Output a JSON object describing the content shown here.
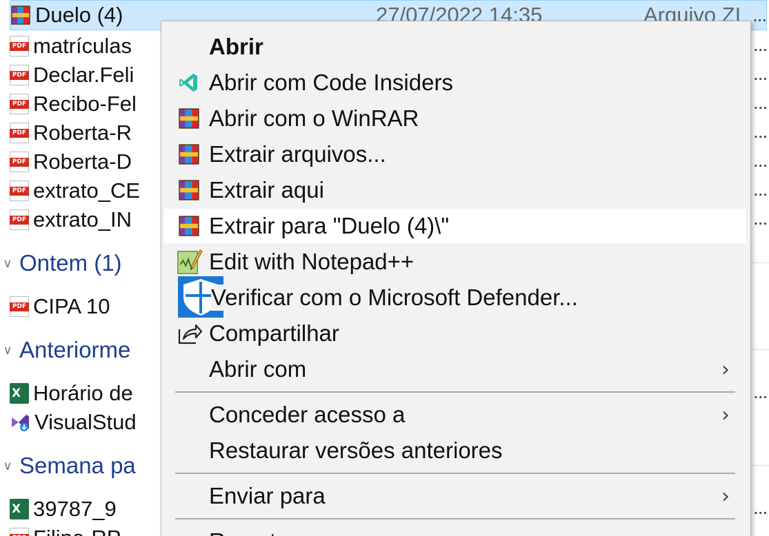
{
  "files": [
    {
      "name": "Duelo (4)",
      "icon": "winrar-archive-icon",
      "date": "27/07/2022 14:35",
      "type": "Arquivo ZI",
      "selected": true
    },
    {
      "name": "matrículas",
      "icon": "pdf-icon"
    },
    {
      "name": "Declar.Feli",
      "icon": "pdf-icon"
    },
    {
      "name": "Recibo-Fel",
      "icon": "pdf-icon"
    },
    {
      "name": "Roberta-R",
      "icon": "pdf-icon"
    },
    {
      "name": "Roberta-D",
      "icon": "pdf-icon"
    },
    {
      "name": "extrato_CE",
      "icon": "pdf-icon"
    },
    {
      "name": "extrato_IN",
      "icon": "pdf-icon"
    }
  ],
  "groups": {
    "yesterday": {
      "label": "Ontem (1)",
      "files": [
        {
          "name": "CIPA 10",
          "icon": "pdf-icon"
        }
      ]
    },
    "earlier": {
      "label": "Anteriorme",
      "files": [
        {
          "name": "Horário de",
          "icon": "excel-icon"
        },
        {
          "name": "VisualStud",
          "icon": "visual-studio-installer-icon"
        }
      ]
    },
    "last_week": {
      "label": "Semana pa",
      "files": [
        {
          "name": "39787_9",
          "icon": "excel-icon"
        },
        {
          "name": "Filipe-RP",
          "icon": "pdf-icon"
        }
      ]
    }
  },
  "ellipsis": "...",
  "context_menu": {
    "items": [
      {
        "label": "Abrir",
        "bold": true,
        "icon": ""
      },
      {
        "label": "Abrir com Code Insiders",
        "icon": "vscode-insiders-icon"
      },
      {
        "label": "Abrir com o WinRAR",
        "icon": "winrar-icon"
      },
      {
        "label": "Extrair arquivos...",
        "icon": "winrar-icon"
      },
      {
        "label": "Extrair aqui",
        "icon": "winrar-icon"
      },
      {
        "label": "Extrair para \"Duelo (4)\\\"",
        "icon": "winrar-icon",
        "hover": true
      },
      {
        "label": "Edit with Notepad++",
        "icon": "notepad-plus-plus-icon"
      },
      {
        "label": "Verificar com o Microsoft Defender...",
        "icon": "defender-shield-icon"
      },
      {
        "label": "Compartilhar",
        "icon": "share-icon"
      },
      {
        "label": "Abrir com",
        "icon": "",
        "submenu": true
      },
      {
        "label": "Conceder acesso a",
        "icon": "",
        "submenu": true
      },
      {
        "label": "Restaurar versões anteriores",
        "icon": ""
      },
      {
        "label": "Enviar para",
        "icon": "",
        "submenu": true
      },
      {
        "label": "Recortar",
        "icon": ""
      }
    ],
    "submenu_arrow": "›"
  },
  "colors": {
    "selection": "#cce8ff",
    "group_header": "#1e3e8f",
    "menu_bg": "#f2f2f2",
    "menu_hover": "#ffffff"
  }
}
